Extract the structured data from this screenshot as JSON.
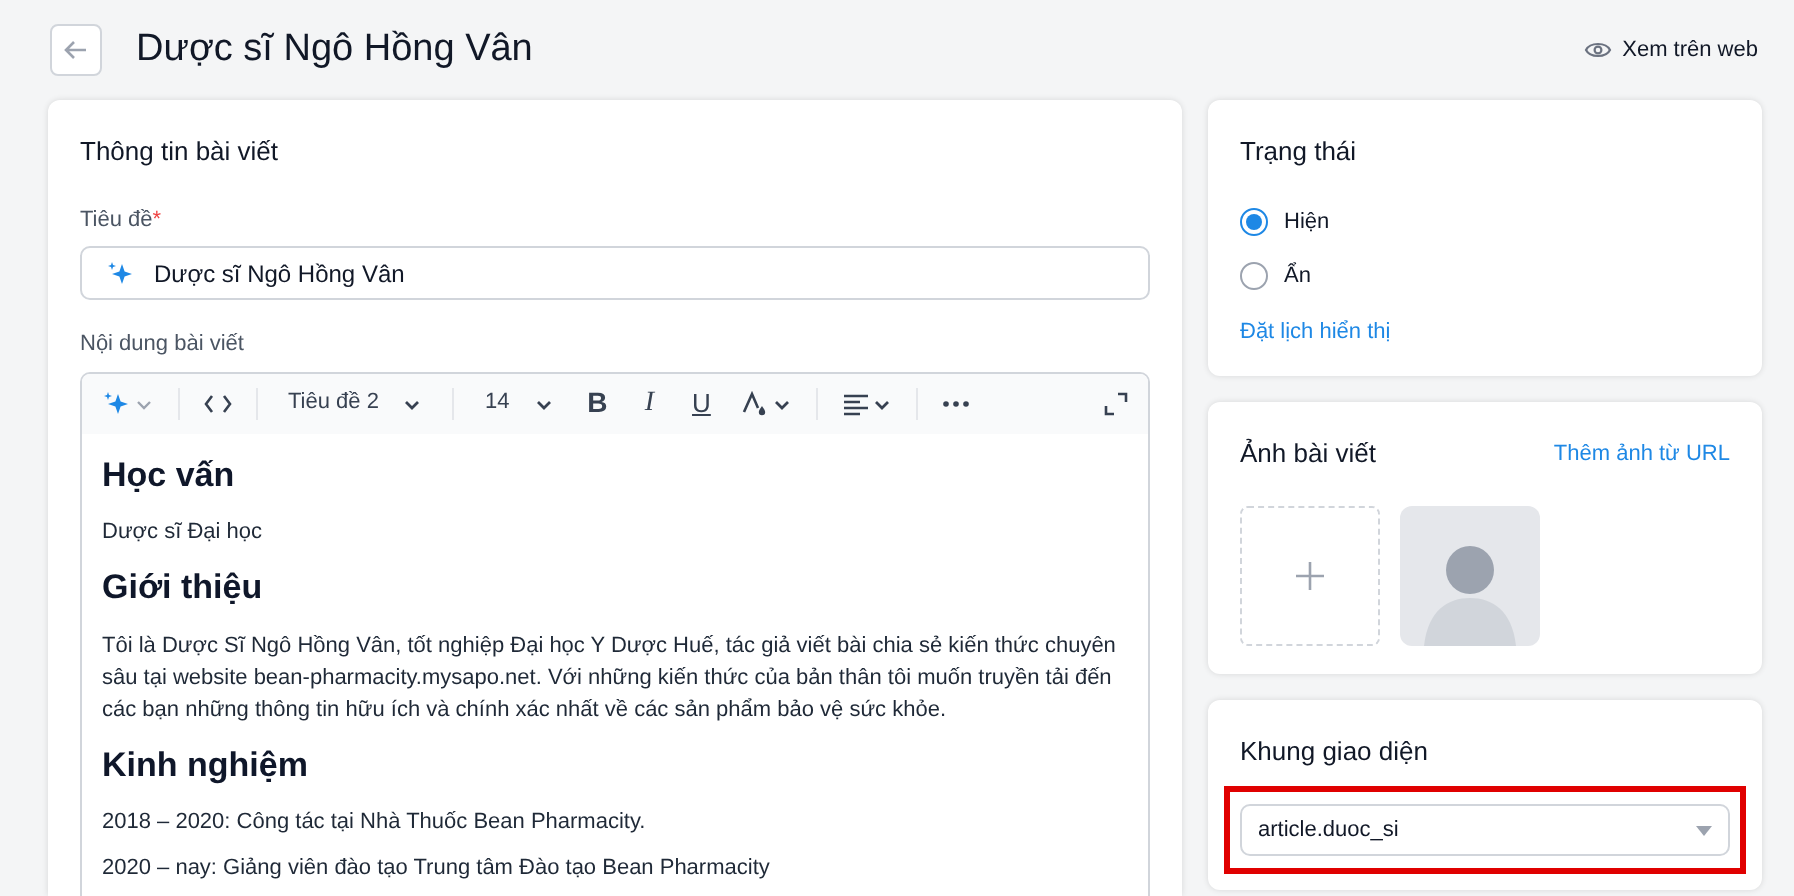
{
  "header": {
    "title": "Dược sĩ Ngô Hồng Vân",
    "view_link": "Xem trên web"
  },
  "article_card": {
    "title": "Thông tin bài viết",
    "title_field": {
      "label": "Tiêu đề",
      "required_mark": "*",
      "value": "Dược sĩ Ngô Hồng Vân"
    },
    "content_label": "Nội dung bài viết",
    "toolbar": [
      {
        "kind": "ai"
      },
      {
        "kind": "divider"
      },
      {
        "kind": "code"
      },
      {
        "kind": "divider"
      },
      {
        "kind": "select",
        "label": "Tiêu đề 2"
      },
      {
        "kind": "divider"
      },
      {
        "kind": "select",
        "label": "14"
      },
      {
        "kind": "bold",
        "label": "B"
      },
      {
        "kind": "italic",
        "label": "I"
      },
      {
        "kind": "underline",
        "label": "U"
      },
      {
        "kind": "color"
      },
      {
        "kind": "divider"
      },
      {
        "kind": "align"
      },
      {
        "kind": "divider"
      },
      {
        "kind": "more"
      },
      {
        "kind": "expand"
      }
    ],
    "content": [
      {
        "kind": "heading",
        "text": "Học vấn"
      },
      {
        "kind": "paragraph",
        "text": "Dược sĩ Đại học"
      },
      {
        "kind": "heading",
        "text": "Giới thiệu"
      },
      {
        "kind": "paragraph",
        "text": "Tôi là Dược Sĩ Ngô Hồng Vân, tốt nghiệp Đại học Y Dược Huế, tác giả viết bài chia sẻ kiến thức chuyên sâu tại website bean-pharmacity.mysapo.net. Với những kiến thức của bản thân tôi muốn truyền tải đến các bạn những thông tin hữu ích và chính xác nhất về các sản phẩm bảo vệ sức khỏe."
      },
      {
        "kind": "heading",
        "text": "Kinh nghiệm"
      },
      {
        "kind": "paragraph",
        "text": "2018 – 2020: Công tác tại Nhà Thuốc Bean Pharmacity."
      },
      {
        "kind": "paragraph",
        "text": "2020 – nay: Giảng viên đào tạo Trung tâm Đào tạo Bean Pharmacity"
      }
    ]
  },
  "status_card": {
    "title": "Trạng thái",
    "options": [
      {
        "label": "Hiện",
        "selected": true
      },
      {
        "label": "Ẩn",
        "selected": false
      }
    ],
    "schedule_link": "Đặt lịch hiển thị"
  },
  "image_card": {
    "title": "Ảnh bài viết",
    "url_link": "Thêm ảnh từ URL"
  },
  "template_card": {
    "title": "Khung giao diện",
    "value": "article.duoc_si",
    "highlighted": true
  }
}
